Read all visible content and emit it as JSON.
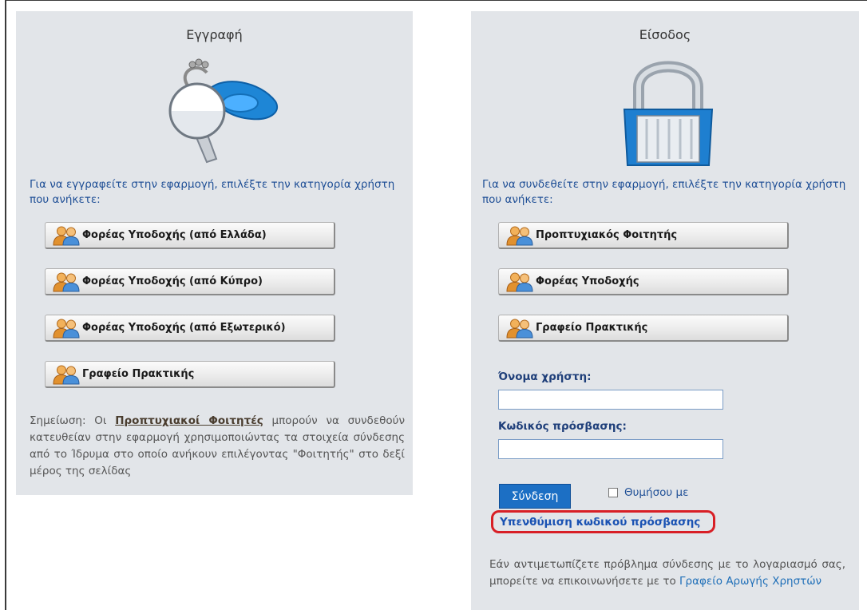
{
  "register": {
    "title": "Εγγραφή",
    "intro": "Για να εγγραφείτε στην εφαρμογή, επιλέξτε την κατηγορία χρήστη που ανήκετε:",
    "buttons": [
      {
        "label": "Φορέας Υποδοχής (από Ελλάδα)"
      },
      {
        "label": "Φορέας Υποδοχής (από Κύπρο)"
      },
      {
        "label": "Φορέας Υποδοχής (από Εξωτερικό)"
      },
      {
        "label": "Γραφείο Πρακτικής"
      }
    ],
    "note_prefix": "Σημείωση: Οι ",
    "note_link": "Προπτυχιακοί Φοιτητές",
    "note_suffix": " μπορούν να συνδεθούν κατευθείαν στην εφαρμογή χρησιμοποιώντας τα στοιχεία σύνδεσης από το Ίδρυμα στο οποίο ανήκουν επιλέγοντας \"Φοιτητής\" στο δεξί μέρος της σελίδας"
  },
  "login": {
    "title": "Είσοδος",
    "intro": "Για να συνδεθείτε στην εφαρμογή, επιλέξτε την κατηγορία χρήστη που ανήκετε:",
    "buttons": [
      {
        "label": "Προπτυχιακός Φοιτητής"
      },
      {
        "label": "Φορέας Υποδοχής"
      },
      {
        "label": "Γραφείο Πρακτικής"
      }
    ],
    "username_label": "Όνομα χρήστη:",
    "username_value": "",
    "password_label": "Κωδικός πρόσβασης:",
    "password_value": "",
    "submit_label": "Σύνδεση",
    "remember_label": "Θυμήσου με",
    "forgot_label": "Υπενθύμιση κωδικού πρόσβασης",
    "help_text": "Εάν αντιμετωπίζετε πρόβλημα σύνδεσης με το λογαριασμό σας, μπορείτε να επικοινωνήσετε με το ",
    "help_link": "Γραφείο Αρωγής Χρηστών"
  },
  "icons": {
    "register_illustration": "key-icon",
    "login_illustration": "padlock-icon",
    "button_icon": "users-icon"
  }
}
